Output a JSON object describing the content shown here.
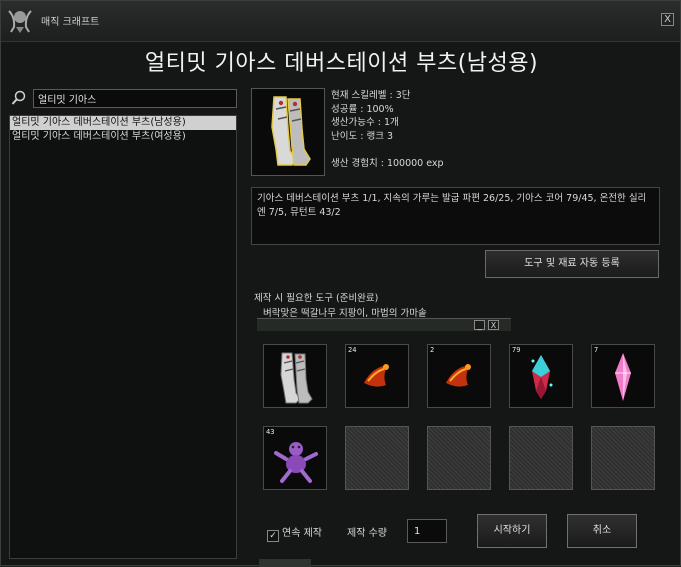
{
  "window": {
    "title": "매직 크래프트",
    "close_label": "X"
  },
  "item": {
    "title": "얼티밋 기아스 데버스테이션 부츠(남성용)"
  },
  "search": {
    "value": "얼티밋 기아스"
  },
  "recipes": [
    {
      "label": "얼티밋 기아스 데버스테이션 부츠(남성용)",
      "selected": true
    },
    {
      "label": "얼티밋 기아스 데버스테이션 부츠(여성용)",
      "selected": false
    }
  ],
  "stats": {
    "skill_level": "현재 스킬레벨 : 3단",
    "success_rate": "성공률 : 100%",
    "craftable": "생산가능수 : 1개",
    "difficulty": "난이도 : 랭크 3",
    "exp": "생산 경험치 : 100000 exp"
  },
  "materials": "기아스 데버스테이션 부츠 1/1, 지속의 가루는 발굽 파편 26/25, 기아스 코어 79/45, 온전한 실리엔 7/5, 뮤턴트 43/2",
  "buttons": {
    "auto_register": "도구 및 재료 자동 등록",
    "start": "시작하기",
    "cancel": "취소",
    "minimize": "_",
    "close": "X"
  },
  "tools": {
    "label": "제작 시 필요한 도구 (준비완료)",
    "value": "벼락맞은 떡갈나무 지팡이, 마법의 가마솥"
  },
  "slots": [
    {
      "count": "",
      "icon": "boots-icon"
    },
    {
      "count": "24",
      "icon": "hoof-fragment-icon"
    },
    {
      "count": "2",
      "icon": "hoof-fragment-icon"
    },
    {
      "count": "79",
      "icon": "gias-core-icon"
    },
    {
      "count": "7",
      "icon": "silien-crystal-icon"
    },
    {
      "count": "43",
      "icon": "mutant-icon"
    }
  ],
  "options": {
    "continuous_label": "연속 제작",
    "continuous_checked": true,
    "quantity_label": "제작 수량",
    "quantity_value": "1"
  }
}
